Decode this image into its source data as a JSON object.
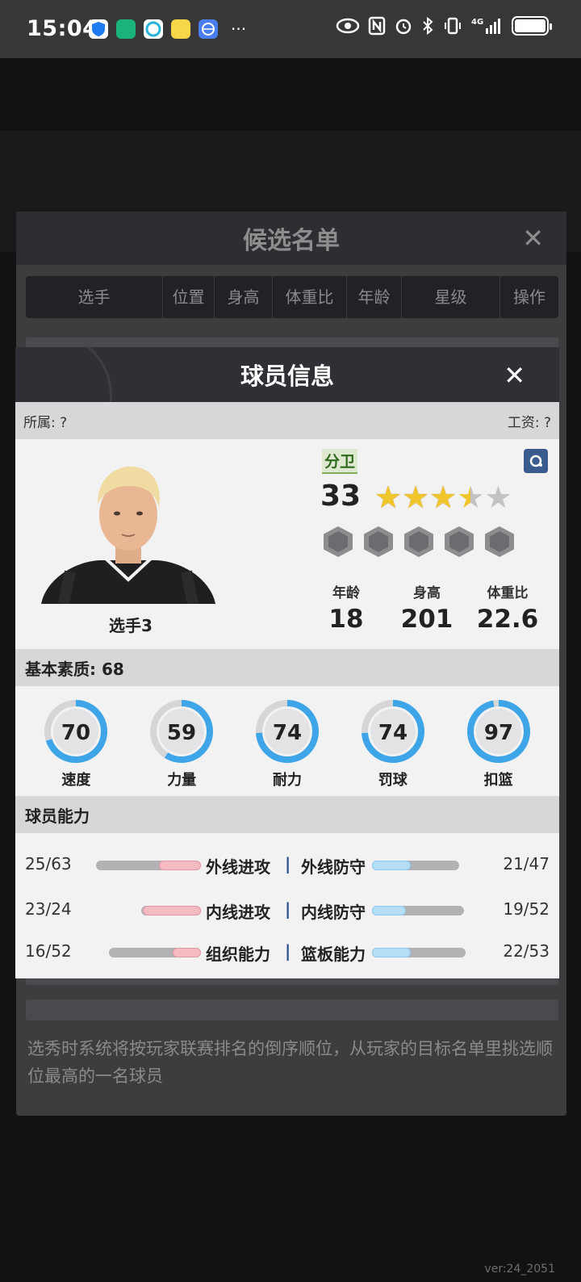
{
  "status_bar": {
    "time": "15:04",
    "more": "···",
    "network": "4G"
  },
  "candidate_list": {
    "title": "候选名单",
    "columns": [
      "选手",
      "位置",
      "身高",
      "体重比",
      "年龄",
      "星级",
      "操作"
    ],
    "note": "选秀时系统将按玩家联赛排名的倒序顺位，从玩家的目标名单里挑选顺位最高的一名球员"
  },
  "modal": {
    "title": "球员信息",
    "owner_label": "所属: ?",
    "salary_label": "工资: ?",
    "player": {
      "name": "选手3",
      "position": "分卫",
      "rating": "33",
      "stars": 3.5,
      "stars_total": 5,
      "age_label": "年龄",
      "age": "18",
      "height_label": "身高",
      "height": "201",
      "weight_ratio_label": "体重比",
      "weight_ratio": "22.6"
    },
    "basic_quality_title": "基本素质: 68",
    "basic_quality": [
      {
        "label": "速度",
        "value": 70
      },
      {
        "label": "力量",
        "value": 59
      },
      {
        "label": "耐力",
        "value": 74
      },
      {
        "label": "罚球",
        "value": 74
      },
      {
        "label": "扣篮",
        "value": 97
      }
    ],
    "abilities_title": "球员能力",
    "abilities": [
      {
        "left_value": "25/63",
        "left_name": "外线进攻",
        "right_name": "外线防守",
        "right_value": "21/47",
        "left_cur": 25,
        "left_max": 63,
        "right_cur": 21,
        "right_max": 47
      },
      {
        "left_value": "23/24",
        "left_name": "内线进攻",
        "right_name": "内线防守",
        "right_value": "19/52",
        "left_cur": 23,
        "left_max": 24,
        "right_cur": 19,
        "right_max": 52
      },
      {
        "left_value": "16/52",
        "left_name": "组织能力",
        "right_name": "篮板能力",
        "right_value": "22/53",
        "left_cur": 16,
        "left_max": 52,
        "right_cur": 22,
        "right_max": 53
      }
    ],
    "separator": "|"
  },
  "version": "ver:24_2051",
  "colors": {
    "ring_blue": "#3ea6e8",
    "ring_track": "#d6d6d8",
    "attack_bar": "#f5b9c2",
    "defense_bar": "#b6def7",
    "header_dark": "#2f3036"
  }
}
